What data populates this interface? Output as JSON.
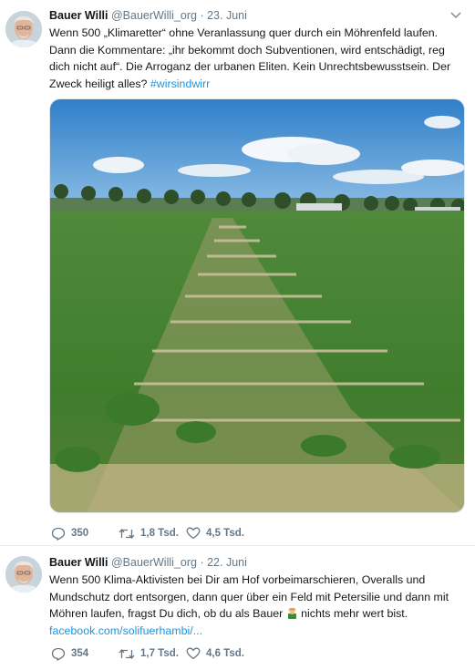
{
  "tweets": [
    {
      "name": "Bauer Willi",
      "handle": "@BauerWilli_org",
      "separator": "·",
      "date": "23. Juni",
      "text": "Wenn 500 „Klimaretter“ ohne Veranlassung quer durch ein Möhrenfeld laufen. Dann die Kommentare: „ihr bekommt doch Subventionen, wird entschädigt, reg dich nicht auf“.  Die Arroganz der urbanen Eliten. Kein Unrechtsbewusstsein. Der Zweck heiligt alles?",
      "hashtag": "#wirsindwirr",
      "replies": "350",
      "retweets": "1,8 Tsd.",
      "likes": "4,5 Tsd."
    },
    {
      "name": "Bauer Willi",
      "handle": "@BauerWilli_org",
      "separator": "·",
      "date": "22. Juni",
      "text": "Wenn 500 Klima-Aktivisten bei Dir am Hof vorbeimarschieren, Overalls und Mundschutz dort entsorgen, dann quer über ein Feld mit Petersilie und dann mit Möhren laufen, fragst Du dich, ob du als Bauer",
      "text_tail": " nichts mehr wert bist.",
      "link": "facebook.com/solifuerhambi/...",
      "emoji": "farmer-emoji",
      "replies": "354",
      "retweets": "1,7 Tsd.",
      "likes": "4,6 Tsd."
    }
  ],
  "colors": {
    "text": "#14171a",
    "muted": "#657786",
    "link": "#1b95e0",
    "border": "#e6ecf0"
  }
}
